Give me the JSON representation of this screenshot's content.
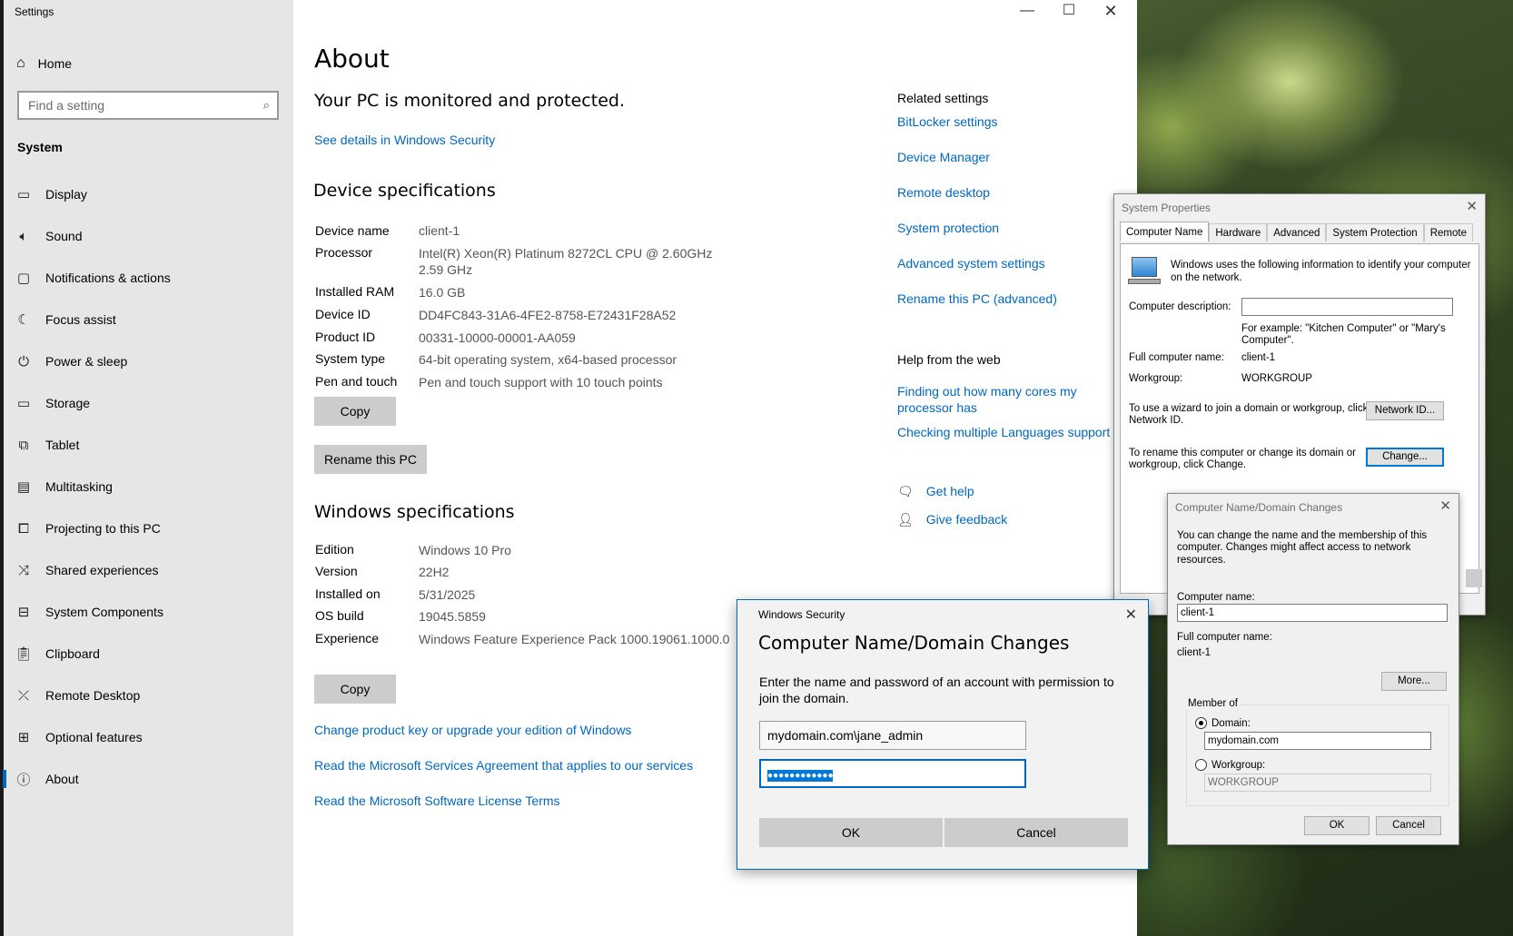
{
  "window": {
    "title": "Settings"
  },
  "sidebar": {
    "home": "Home",
    "search_placeholder": "Find a setting",
    "section": "System",
    "items": [
      {
        "label": "Display",
        "icon": "monitor-icon"
      },
      {
        "label": "Sound",
        "icon": "speaker-icon"
      },
      {
        "label": "Notifications & actions",
        "icon": "notification-icon"
      },
      {
        "label": "Focus assist",
        "icon": "moon-icon"
      },
      {
        "label": "Power & sleep",
        "icon": "power-icon"
      },
      {
        "label": "Storage",
        "icon": "storage-icon"
      },
      {
        "label": "Tablet",
        "icon": "tablet-icon"
      },
      {
        "label": "Multitasking",
        "icon": "multitasking-icon"
      },
      {
        "label": "Projecting to this PC",
        "icon": "projecting-icon"
      },
      {
        "label": "Shared experiences",
        "icon": "shared-icon"
      },
      {
        "label": "System Components",
        "icon": "components-icon"
      },
      {
        "label": "Clipboard",
        "icon": "clipboard-icon"
      },
      {
        "label": "Remote Desktop",
        "icon": "remote-desktop-icon"
      },
      {
        "label": "Optional features",
        "icon": "optional-features-icon"
      },
      {
        "label": "About",
        "icon": "info-icon",
        "active": true
      }
    ]
  },
  "main": {
    "title": "About",
    "protected_heading": "Your PC is monitored and protected.",
    "security_link": "See details in Windows Security",
    "device_specs": {
      "heading": "Device specifications",
      "rows": [
        {
          "label": "Device name",
          "value": "client-1"
        },
        {
          "label": "Processor",
          "value": "Intel(R) Xeon(R) Platinum 8272CL CPU @ 2.60GHz",
          "value2": "2.59 GHz"
        },
        {
          "label": "Installed RAM",
          "value": "16.0 GB"
        },
        {
          "label": "Device ID",
          "value": "DD4FC843-31A6-4FE2-8758-E72431F28A52"
        },
        {
          "label": "Product ID",
          "value": "00331-10000-00001-AA059"
        },
        {
          "label": "System type",
          "value": "64-bit operating system, x64-based processor"
        },
        {
          "label": "Pen and touch",
          "value": "Pen and touch support with 10 touch points"
        }
      ],
      "copy_button": "Copy",
      "rename_button": "Rename this PC"
    },
    "windows_specs": {
      "heading": "Windows specifications",
      "rows": [
        {
          "label": "Edition",
          "value": "Windows 10 Pro"
        },
        {
          "label": "Version",
          "value": "22H2"
        },
        {
          "label": "Installed on",
          "value": "5/31/2025"
        },
        {
          "label": "OS build",
          "value": "19045.5859"
        },
        {
          "label": "Experience",
          "value": "Windows Feature Experience Pack 1000.19061.1000.0"
        }
      ],
      "copy_button": "Copy"
    },
    "links": [
      "Change product key or upgrade your edition of Windows",
      "Read the Microsoft Services Agreement that applies to our services",
      "Read the Microsoft Software License Terms"
    ]
  },
  "related": {
    "heading": "Related settings",
    "links": [
      "BitLocker settings",
      "Device Manager",
      "Remote desktop",
      "System protection",
      "Advanced system settings",
      "Rename this PC (advanced)"
    ],
    "web_heading": "Help from the web",
    "web_link1_line1": "Finding out how many cores my",
    "web_link1_line2": "processor has",
    "web_link2": "Checking multiple Languages support",
    "get_help": "Get help",
    "give_feedback": "Give feedback"
  },
  "system_properties": {
    "title": "System Properties",
    "tabs": [
      "Computer Name",
      "Hardware",
      "Advanced",
      "System Protection",
      "Remote"
    ],
    "info_line1": "Windows uses the following information to identify your computer",
    "info_line2": "on the network.",
    "description_label": "Computer description:",
    "description_value": "",
    "example_line1": "For example: \"Kitchen Computer\" or \"Mary's",
    "example_line2": "Computer\".",
    "full_name_label": "Full computer name:",
    "full_name_value": "client-1",
    "workgroup_label": "Workgroup:",
    "workgroup_value": "WORKGROUP",
    "wizard_line1": "To use a wizard to join a domain or workgroup, click",
    "wizard_line2": "Network ID.",
    "network_id_button": "Network ID...",
    "rename_line1": "To rename this computer or change its domain or",
    "rename_line2": "workgroup, click Change.",
    "change_button": "Change..."
  },
  "computer_name_changes": {
    "title": "Computer Name/Domain Changes",
    "desc_line1": "You can change the name and the membership of this",
    "desc_line2": "computer. Changes might affect access to network resources.",
    "computer_name_label": "Computer name:",
    "computer_name_value": "client-1",
    "full_name_label": "Full computer name:",
    "full_name_value": "client-1",
    "more_button": "More...",
    "member_of_label": "Member of",
    "domain_label": "Domain:",
    "domain_value": "mydomain.com",
    "workgroup_label": "Workgroup:",
    "workgroup_value": "WORKGROUP",
    "ok_button": "OK",
    "cancel_button": "Cancel"
  },
  "windows_security": {
    "small_title": "Windows Security",
    "title": "Computer Name/Domain Changes",
    "description": "Enter the name and password of an account with permission to join the domain.",
    "username_value": "mydomain.com\\jane_admin",
    "password_mask": "●●●●●●●●●●●●",
    "ok_button": "OK",
    "cancel_button": "Cancel"
  },
  "colors": {
    "accent": "#0067c0",
    "sidebar_bg": "#e6e6e6",
    "button_gray": "#cccccc"
  }
}
